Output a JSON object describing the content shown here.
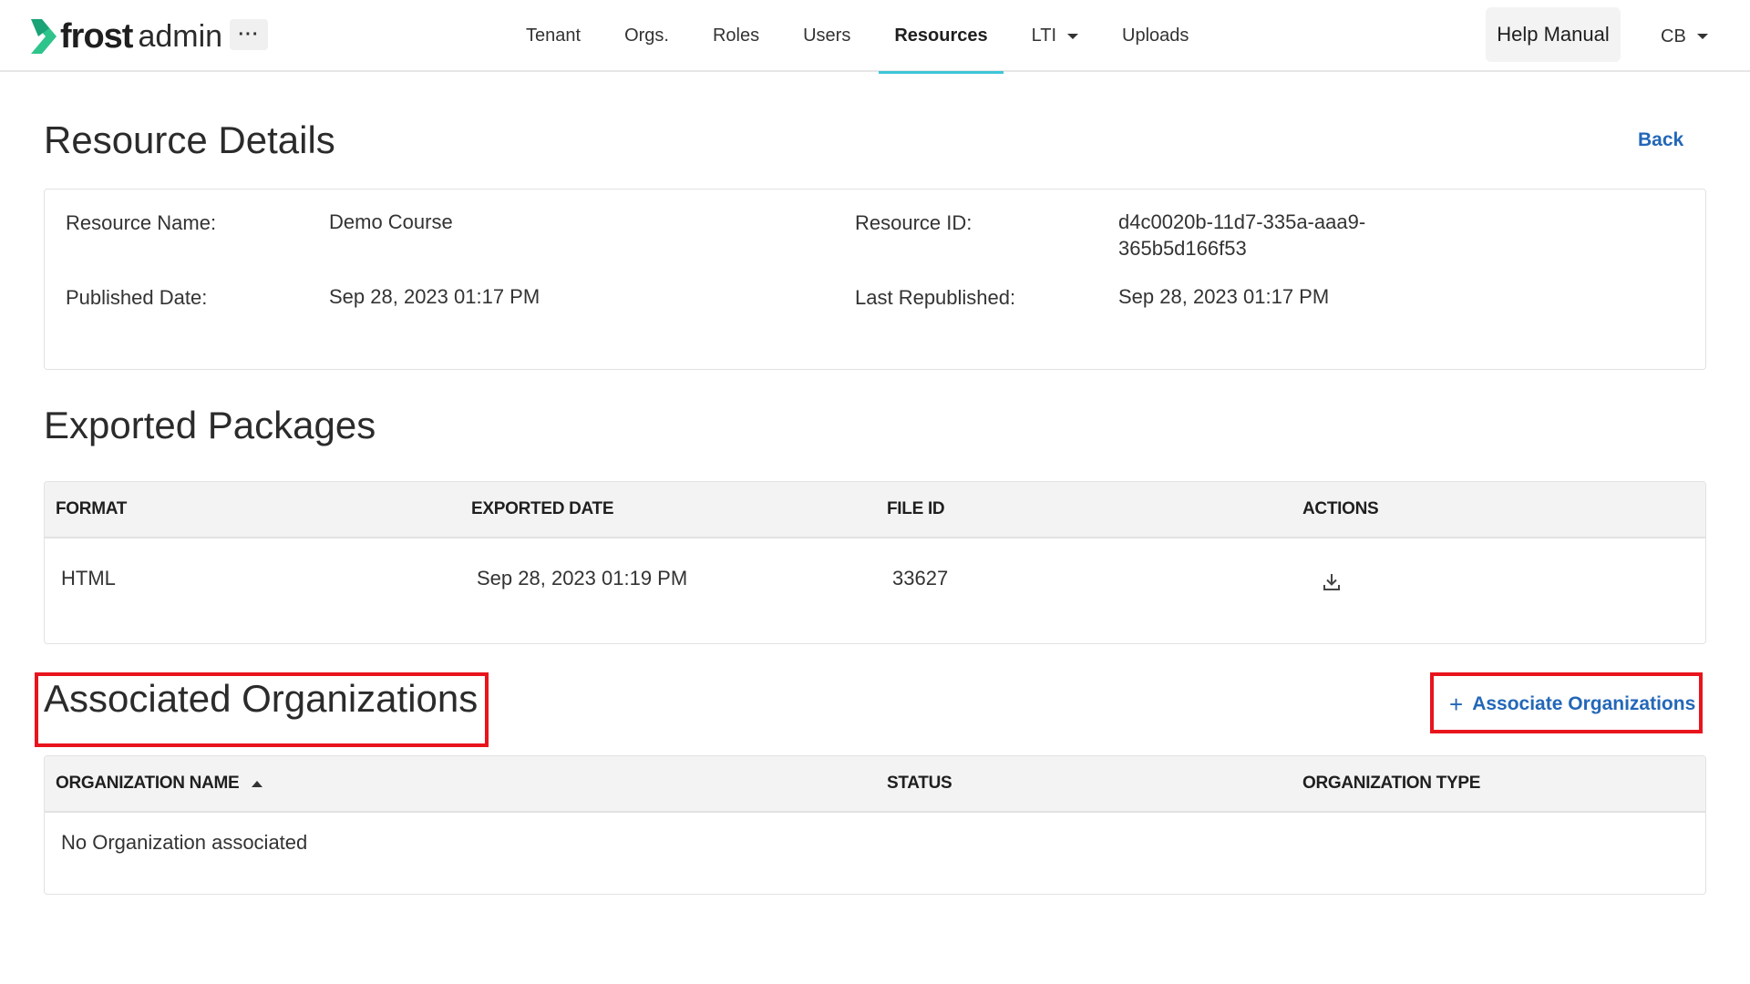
{
  "app": {
    "logo_bold": "frost",
    "logo_light": "admin",
    "more_label": "···",
    "brand_color": "#2ec48c"
  },
  "nav": {
    "items": [
      {
        "label": "Tenant"
      },
      {
        "label": "Orgs."
      },
      {
        "label": "Roles"
      },
      {
        "label": "Users"
      },
      {
        "label": "Resources"
      },
      {
        "label": "LTI"
      },
      {
        "label": "Uploads"
      }
    ],
    "active": "Resources",
    "help_label": "Help Manual",
    "user_initials": "CB"
  },
  "details": {
    "title": "Resource Details",
    "back_label": "Back",
    "name_label": "Resource Name:",
    "name_value": "Demo Course",
    "id_label": "Resource ID:",
    "id_value_line1": "d4c0020b-11d7-335a-aaa9-",
    "id_value_line2": "365b5d166f53",
    "published_label": "Published Date:",
    "published_value": "Sep 28, 2023 01:17 PM",
    "republished_label": "Last Republished:",
    "republished_value": "Sep 28, 2023 01:17 PM"
  },
  "packages": {
    "title": "Exported Packages",
    "columns": [
      "FORMAT",
      "EXPORTED DATE",
      "FILE ID",
      "ACTIONS"
    ],
    "rows": [
      {
        "format": "HTML",
        "exported_date": "Sep 28, 2023 01:19 PM",
        "file_id": "33627",
        "action_icon": "download-icon"
      }
    ]
  },
  "organizations": {
    "title": "Associated Organizations",
    "add_label": "Associate Organizations",
    "add_icon": "plus-icon",
    "columns": [
      "ORGANIZATION NAME",
      "STATUS",
      "ORGANIZATION TYPE"
    ],
    "sort_icon": "sort-ascending-icon",
    "empty_text": "No Organization associated"
  },
  "annotations": {
    "highlight_color": "#e8141c"
  }
}
